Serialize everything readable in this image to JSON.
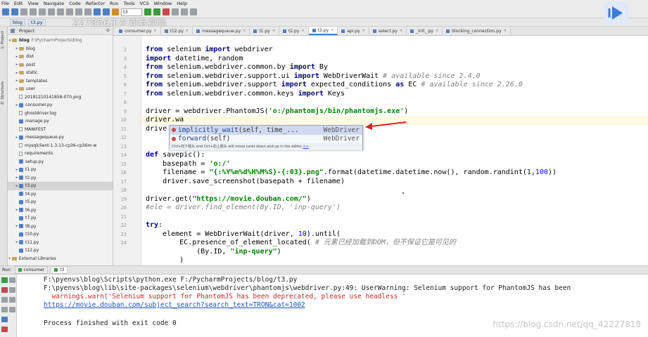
{
  "menu": [
    "File",
    "Edit",
    "View",
    "Navigate",
    "Code",
    "Refactor",
    "Run",
    "Tools",
    "VCS",
    "Window",
    "Help"
  ],
  "toolbar": {
    "run_config": "t3"
  },
  "navbar": {
    "crumbs": [
      "blog",
      "t3.py"
    ]
  },
  "overlay": {
    "text": "227856"
  },
  "sidebar": {
    "labels": [
      "1: Project",
      "Z: Structure"
    ]
  },
  "project": {
    "header": "Project",
    "root": "blog",
    "root_path": "F:\\PycharmProjects\\blog",
    "items": [
      {
        "name": "blog",
        "kind": "folder"
      },
      {
        "name": "dist",
        "kind": "folder"
      },
      {
        "name": "post",
        "kind": "folder"
      },
      {
        "name": "static",
        "kind": "folder"
      },
      {
        "name": "templates",
        "kind": "folder"
      },
      {
        "name": "user",
        "kind": "folder"
      },
      {
        "name": "20181210141858-070.png",
        "kind": "file"
      },
      {
        "name": "consumer.py",
        "kind": "py"
      },
      {
        "name": "ghostdriver.log",
        "kind": "file"
      },
      {
        "name": "manage.py",
        "kind": "py"
      },
      {
        "name": "MANIFEST",
        "kind": "file"
      },
      {
        "name": "messagequeue.py",
        "kind": "py"
      },
      {
        "name": "mysqlclient-1.3.13-cp36-cp36m-w",
        "kind": "file"
      },
      {
        "name": "requirements",
        "kind": "file"
      },
      {
        "name": "setup.py",
        "kind": "py"
      },
      {
        "name": "t1.py",
        "kind": "py"
      },
      {
        "name": "t2.py",
        "kind": "py"
      },
      {
        "name": "t3.py",
        "kind": "py"
      },
      {
        "name": "t4.py",
        "kind": "py"
      },
      {
        "name": "t5.py",
        "kind": "py"
      },
      {
        "name": "t6.py",
        "kind": "py"
      },
      {
        "name": "t7.py",
        "kind": "py"
      },
      {
        "name": "t8.py",
        "kind": "py"
      },
      {
        "name": "t10.py",
        "kind": "py"
      },
      {
        "name": "t11.py",
        "kind": "py"
      },
      {
        "name": "t12.py",
        "kind": "py"
      },
      {
        "name": "External Libraries",
        "kind": "lib"
      }
    ]
  },
  "tabs": [
    "consumer.py",
    "t12.py",
    "messagequeue.py",
    "t1.py",
    "t2.py",
    "t3.py",
    "api.py",
    "select.py",
    "_init_.py",
    "blocking_connection.py"
  ],
  "active_tab": "t3.py",
  "line_numbers": [
    "2",
    "3",
    "4",
    "5",
    "6",
    "7",
    "8",
    "9",
    "10",
    "11",
    "12",
    "13",
    "14",
    "15",
    "16",
    "17",
    "18",
    "19",
    "20",
    "21",
    "22",
    "23",
    "24"
  ],
  "autocomplete": {
    "items": [
      {
        "name": "implicitly_wait",
        "sig": "(self, time_...",
        "type": "WebDriver"
      },
      {
        "name": "forward",
        "sig": "(self)",
        "type": "WebDriver"
      }
    ],
    "hint": "Ctrl+向下箭头 and Ctrl+向上箭头 will move caret down and up in the editor",
    "hint_link": ">>"
  },
  "run": {
    "label": "Run:",
    "tabs": [
      "consumer",
      "t3"
    ],
    "output": [
      "F:\\pyenvs\\blog\\Scripts\\python.exe F:/PycharmProjects/blog/t3.py",
      "F:\\pyenvs\\blog\\lib\\site-packages\\selenium\\webdriver\\phantomjs\\webdriver.py:49",
      ": UserWarning: Selenium support for PhantomJS has been",
      "  warnings.warn('Selenium support for PhantomJS has been deprecated, please use headless '",
      "https://movie.douban.com/subject_search?search_text=TRON&cat=1002",
      "",
      "Process finished with exit code 0"
    ]
  },
  "watermark": "https://blog.csdn.net/qq_42227818"
}
